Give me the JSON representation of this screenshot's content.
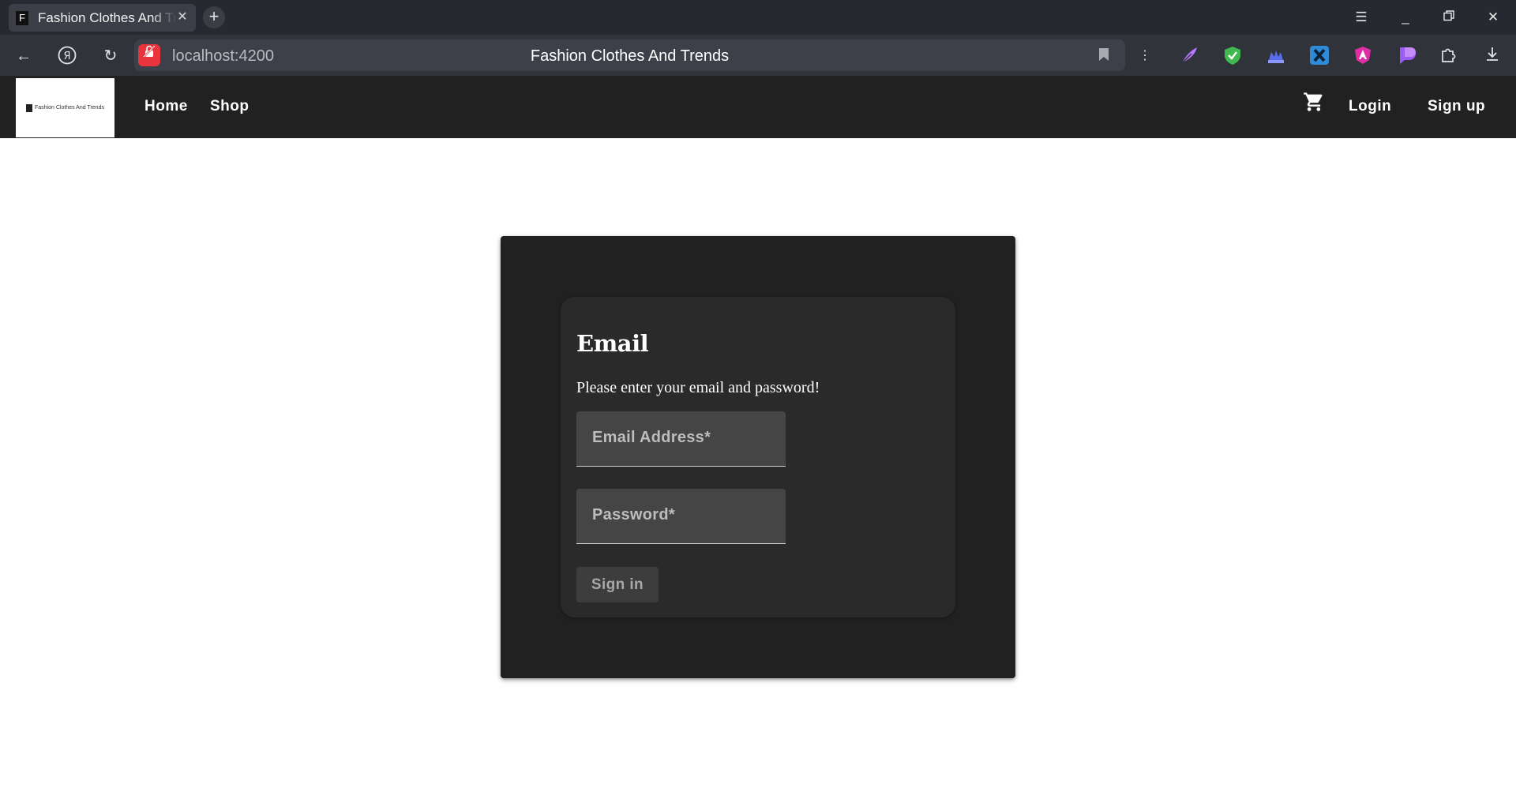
{
  "browser": {
    "tab_title": "Fashion Clothes And Trends",
    "tab_favicon_letter": "F",
    "url": "localhost:4200",
    "page_title": "Fashion Clothes And Trends"
  },
  "nav": {
    "logo_text": "Fashion Clothes And Trends",
    "links": [
      "Home",
      "Shop"
    ],
    "login_label": "Login",
    "signup_label": "Sign up"
  },
  "login": {
    "title": "Email",
    "subtitle": "Please enter your email and password!",
    "email_label": "Email Address*",
    "password_label": "Password*",
    "signin_label": "Sign in"
  },
  "colors": {
    "nav_bg": "#212121",
    "card_bg": "#212121",
    "inner_card_bg": "#2a2a2a",
    "field_bg": "#454545",
    "lock_red": "#e8343c"
  }
}
